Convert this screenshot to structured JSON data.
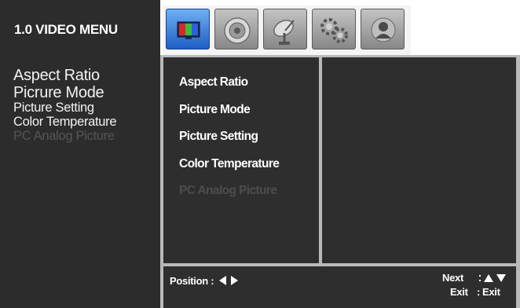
{
  "left_panel": {
    "title": "1.0 VIDEO MENU",
    "items": [
      {
        "label": "Aspect Ratio"
      },
      {
        "label": "Picrure Mode"
      },
      {
        "label": "Picture Setting"
      },
      {
        "label": "Color Temperature"
      },
      {
        "label": "PC Analog Picture"
      }
    ]
  },
  "tabs": [
    {
      "icon": "picture-tab-icon",
      "active": true
    },
    {
      "icon": "sound-tab-icon",
      "active": false
    },
    {
      "icon": "channel-tab-icon",
      "active": false
    },
    {
      "icon": "setup-tab-icon",
      "active": false
    },
    {
      "icon": "user-tab-icon",
      "active": false
    }
  ],
  "menu": {
    "items": [
      {
        "label": "Aspect Ratio"
      },
      {
        "label": "Picture Mode"
      },
      {
        "label": "Picture Setting"
      },
      {
        "label": "Color Temperature"
      },
      {
        "label": "PC Analog Picture"
      }
    ]
  },
  "footer": {
    "position_label": "Position :",
    "next_label": "Next",
    "exit_label": "Exit",
    "exit_value": "Exit",
    "separator": ":"
  },
  "colors": {
    "panel": "#2c2c2c",
    "frame": "#b9b9b9",
    "active_tab": "#3a82dc",
    "disabled_text": "#4d4d4d"
  }
}
